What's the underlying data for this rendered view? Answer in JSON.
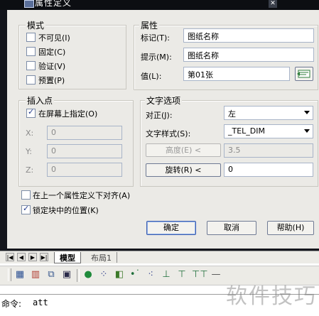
{
  "title": "属性定义",
  "mode": {
    "title": "模式",
    "options": [
      {
        "label": "不可见(I)",
        "checked": false
      },
      {
        "label": "固定(C)",
        "checked": false
      },
      {
        "label": "验证(V)",
        "checked": false
      },
      {
        "label": "预置(P)",
        "checked": false
      }
    ]
  },
  "attribute": {
    "title": "属性",
    "tag_label": "标记(T):",
    "tag_value": "图纸名称",
    "prompt_label": "提示(M):",
    "prompt_value": "图纸名称",
    "value_label": "值(L):",
    "value_value": "第01张"
  },
  "insertion": {
    "title": "插入点",
    "specify_label": "在屏幕上指定(O)",
    "specify_checked": true,
    "x_label": "X:",
    "x_value": "0",
    "y_label": "Y:",
    "y_value": "0",
    "z_label": "Z:",
    "z_value": "0"
  },
  "text_options": {
    "title": "文字选项",
    "justify_label": "对正(J):",
    "justify_value": "左",
    "style_label": "文字样式(S):",
    "style_value": "_TEL_DIM",
    "height_button": "高度(E) <",
    "height_value": "3.5",
    "rotation_button": "旋转(R) <",
    "rotation_value": "0"
  },
  "align_below": {
    "label": "在上一个属性定义下对齐(A)",
    "checked": false
  },
  "lock_position": {
    "label": "锁定块中的位置(K)",
    "checked": true
  },
  "buttons": {
    "ok": "确定",
    "cancel": "取消",
    "help": "帮助(H)"
  },
  "tabs": {
    "model": "模型",
    "layout": "布局1"
  },
  "nav_glyphs": {
    "first": "|◀",
    "prev": "◀",
    "next": "▶",
    "last": "▶|"
  },
  "toolbar_icons": [
    "table-icon",
    "bar-chart-icon",
    "layer-icon",
    "save-icon",
    "green-circle-icon",
    "snap-grid-icon",
    "snap-square-icon",
    "node-dot-icon",
    "arc-dots-icon",
    "axis-icon",
    "dimension-icon",
    "dimension-pair-icon",
    "spacer-line-icon"
  ],
  "toolbar_glyphs": [
    "▦",
    "▥",
    "⧉",
    "▣",
    "●",
    "⁘",
    "◧",
    "•˙",
    "⁖",
    "⊥",
    "⊤",
    "⊤⊤",
    "—"
  ],
  "command": {
    "prompt": "命令:",
    "text": "att"
  },
  "watermark": "软件技巧"
}
